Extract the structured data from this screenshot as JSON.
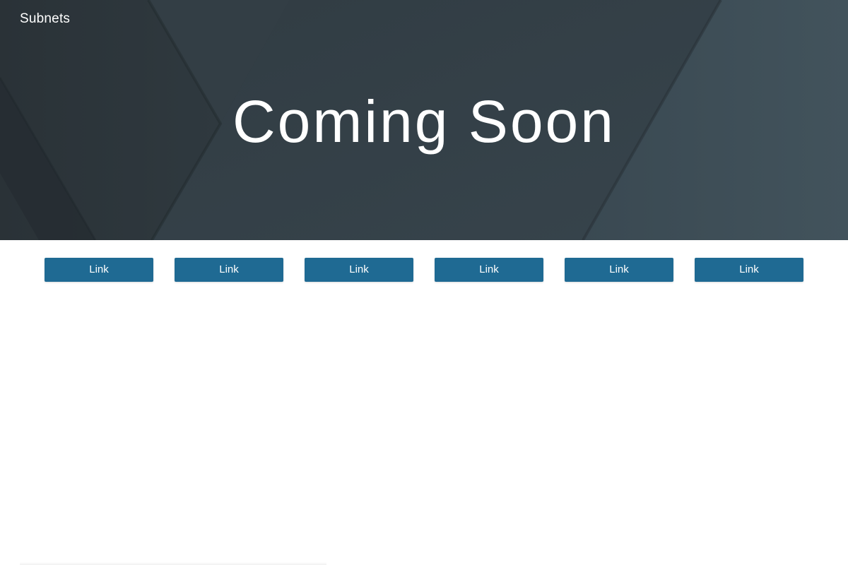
{
  "header": {
    "site_title": "Subnets"
  },
  "hero": {
    "heading": "Coming Soon"
  },
  "links": [
    {
      "label": "Link"
    },
    {
      "label": "Link"
    },
    {
      "label": "Link"
    },
    {
      "label": "Link"
    },
    {
      "label": "Link"
    },
    {
      "label": "Link"
    }
  ],
  "colors": {
    "hero_background": "#323d44",
    "button_background": "#1f6a93",
    "button_text": "#ffffff"
  }
}
